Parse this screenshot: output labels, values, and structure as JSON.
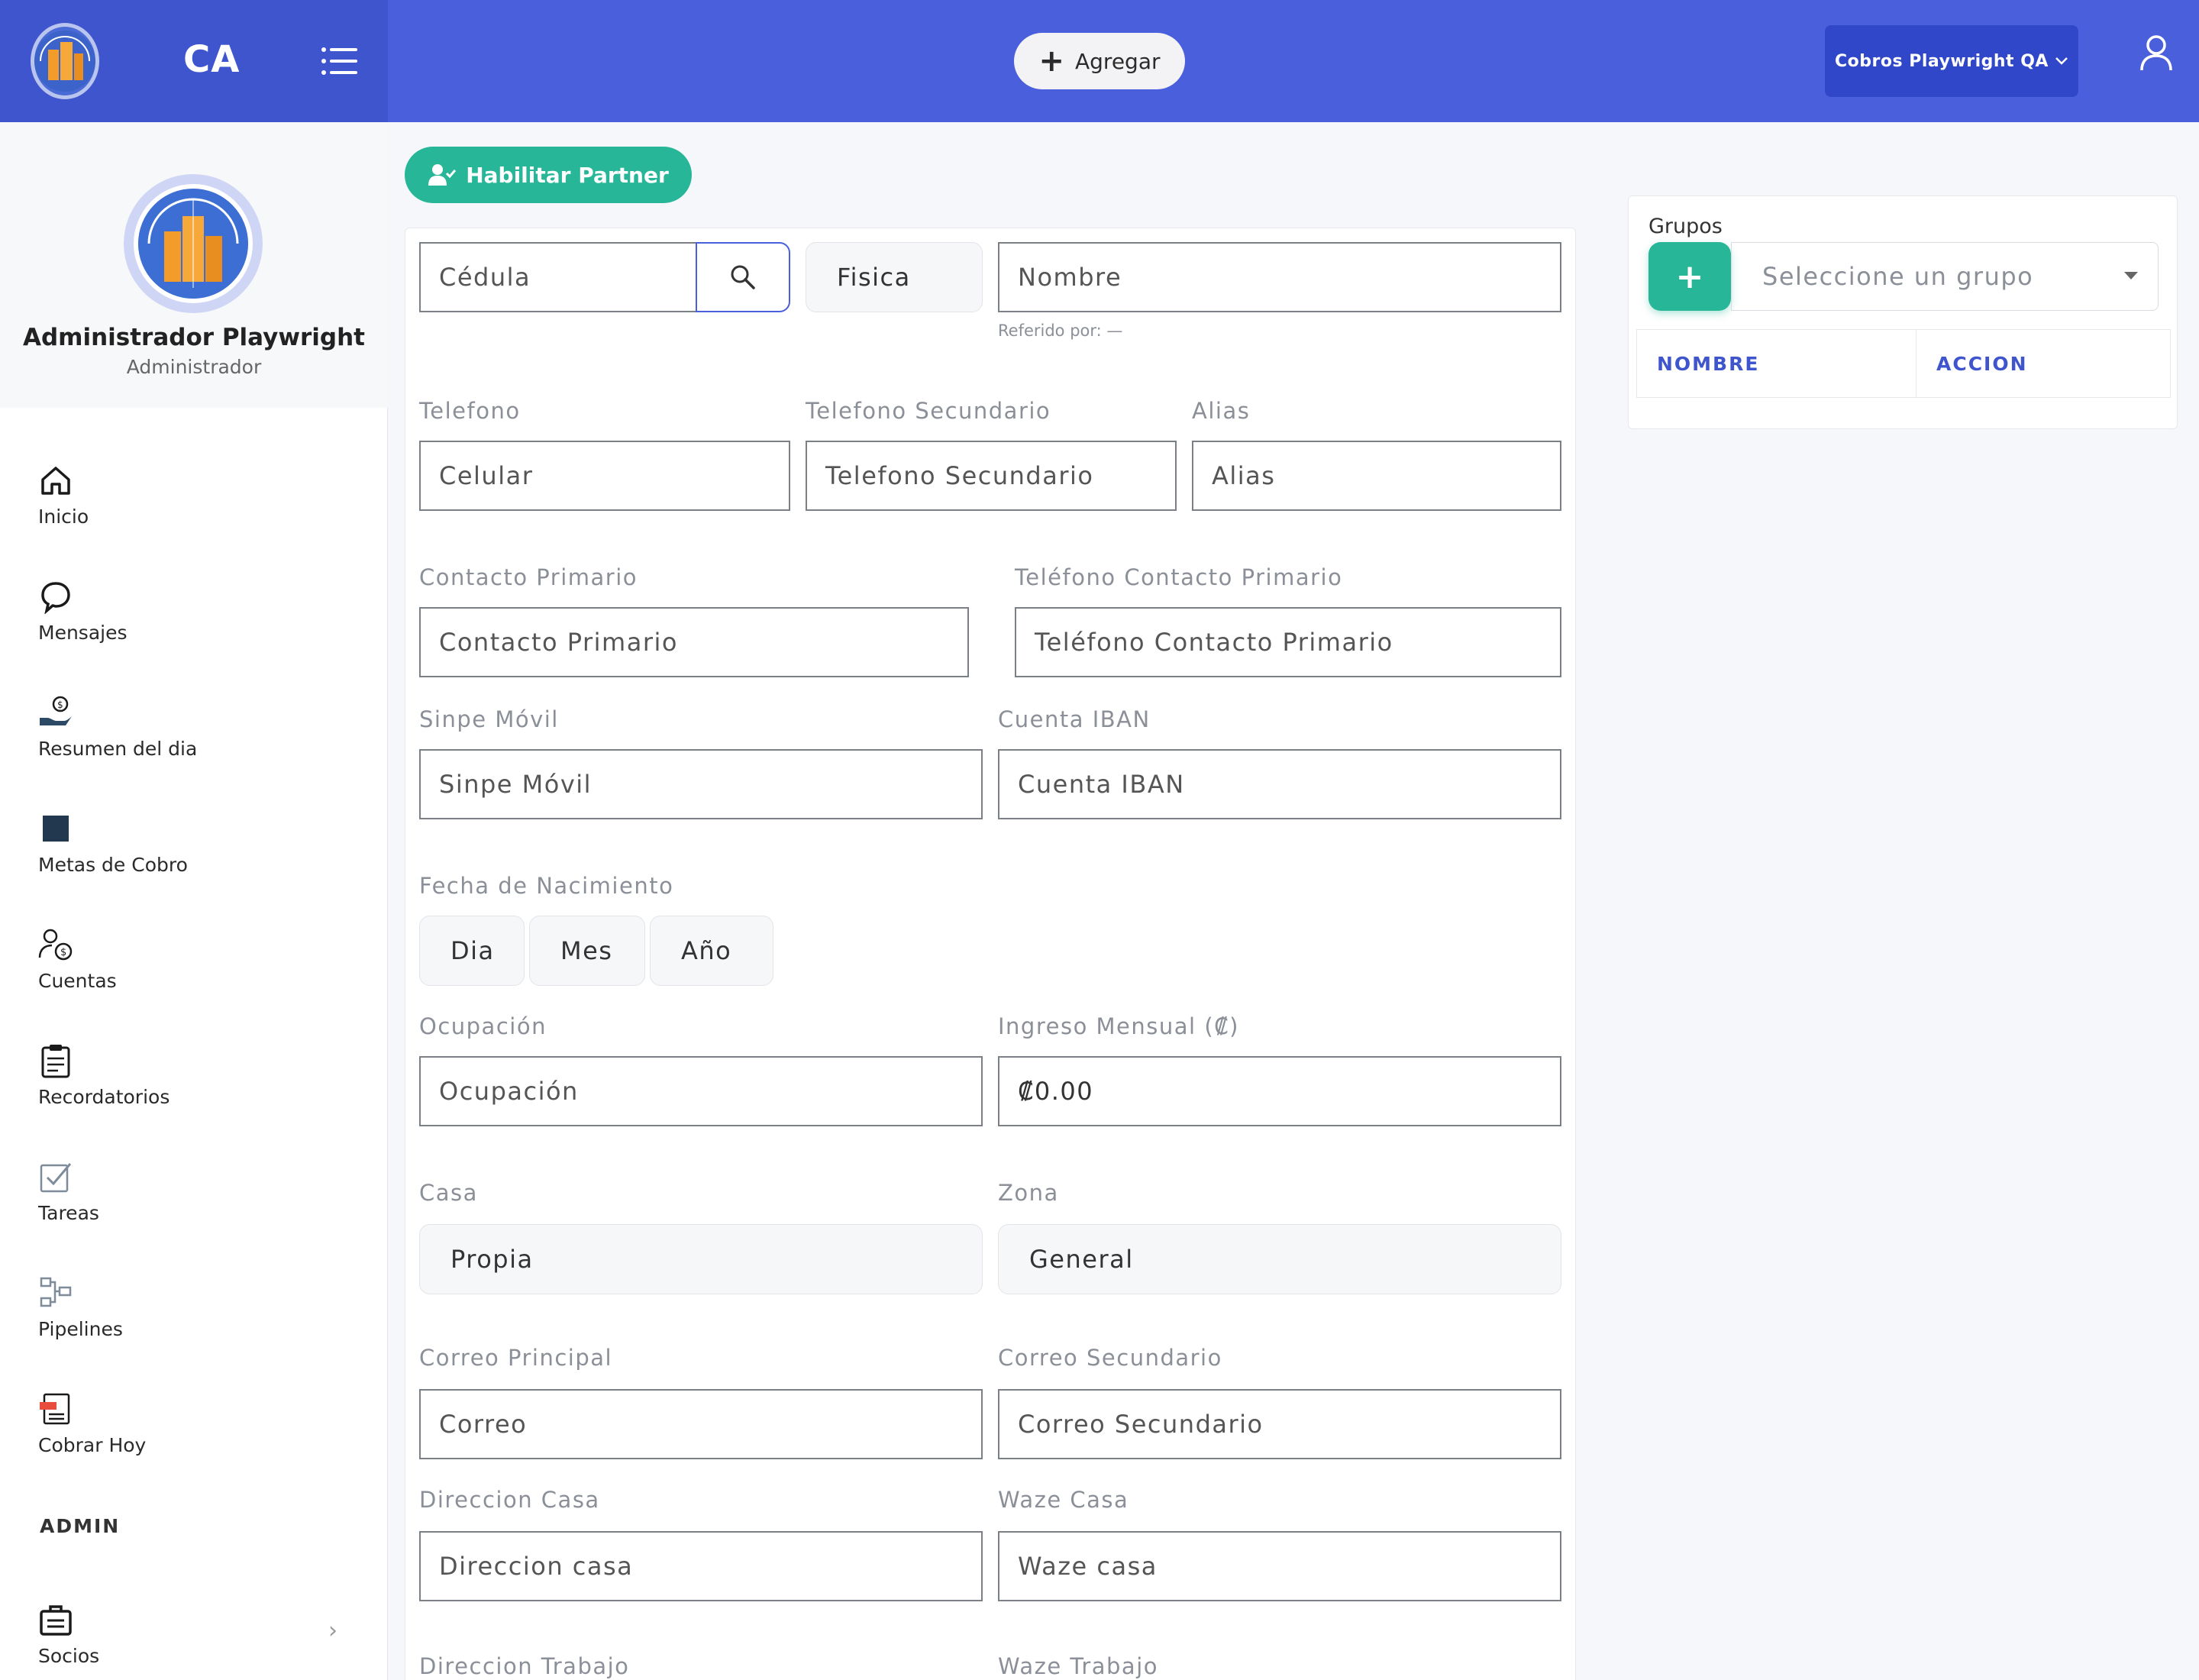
{
  "header": {
    "brand": "CA",
    "add_label": "Agregar",
    "company": "Cobros Playwright QA"
  },
  "profile": {
    "name": "Administrador Playwright",
    "role": "Administrador"
  },
  "sidebar": {
    "items": [
      {
        "label": "Inicio"
      },
      {
        "label": "Mensajes"
      },
      {
        "label": "Resumen del dia"
      },
      {
        "label": "Metas de Cobro"
      },
      {
        "label": "Cuentas"
      },
      {
        "label": "Recordatorios"
      },
      {
        "label": "Tareas"
      },
      {
        "label": "Pipelines"
      },
      {
        "label": "Cobrar Hoy"
      }
    ],
    "section_admin": "ADMIN",
    "admin_items": [
      {
        "label": "Socios"
      }
    ]
  },
  "actions": {
    "enable_partner": "Habilitar Partner"
  },
  "form": {
    "cedula_placeholder": "Cédula",
    "tipo": "Fisica",
    "nombre_placeholder": "Nombre",
    "referido": "Referido por: —",
    "telefono_label": "Telefono",
    "telefono_placeholder": "Celular",
    "tel_sec_label": "Telefono Secundario",
    "tel_sec_placeholder": "Telefono Secundario",
    "alias_label": "Alias",
    "alias_placeholder": "Alias",
    "contacto_label": "Contacto Primario",
    "contacto_placeholder": "Contacto Primario",
    "tel_contacto_label": "Teléfono Contacto Primario",
    "tel_contacto_placeholder": "Teléfono Contacto Primario",
    "sinpe_label": "Sinpe Móvil",
    "sinpe_placeholder": "Sinpe Móvil",
    "iban_label": "Cuenta IBAN",
    "iban_placeholder": "Cuenta IBAN",
    "nacimiento_label": "Fecha de Nacimiento",
    "dia": "Dia",
    "mes": "Mes",
    "anio": "Año",
    "ocupacion_label": "Ocupación",
    "ocupacion_placeholder": "Ocupación",
    "ingreso_label": "Ingreso Mensual (₡)",
    "ingreso_value": "₡0.00",
    "casa_label": "Casa",
    "casa_value": "Propia",
    "zona_label": "Zona",
    "zona_value": "General",
    "correo_label": "Correo Principal",
    "correo_placeholder": "Correo",
    "correo_sec_label": "Correo Secundario",
    "correo_sec_placeholder": "Correo Secundario",
    "dir_casa_label": "Direccion Casa",
    "dir_casa_placeholder": "Direccion casa",
    "waze_casa_label": "Waze Casa",
    "waze_casa_placeholder": "Waze casa",
    "dir_trabajo_label": "Direccion Trabajo",
    "waze_trabajo_label": "Waze Trabajo"
  },
  "groups": {
    "title": "Grupos",
    "add": "+",
    "select_placeholder": "Seleccione un grupo",
    "columns": [
      "NOMBRE",
      "ACCION"
    ]
  },
  "colors": {
    "primary": "#4a5fdc",
    "brand_dark": "#3e55cd",
    "accent": "#27b798"
  }
}
